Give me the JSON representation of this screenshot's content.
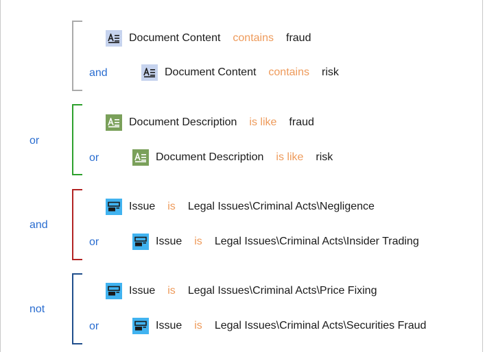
{
  "groups": [
    {
      "op": "",
      "color": "#aaaaaa",
      "conditions": [
        {
          "join": "",
          "field": "Document Content",
          "operator": "contains",
          "value": "fraud",
          "icon": "text-field-icon"
        },
        {
          "join": "and",
          "field": "Document Content",
          "operator": "contains",
          "value": "risk",
          "icon": "text-field-icon"
        }
      ]
    },
    {
      "op": "or",
      "color": "#2ca02c",
      "conditions": [
        {
          "join": "",
          "field": "Document Description",
          "operator": "is like",
          "value": "fraud",
          "icon": "text-field-icon"
        },
        {
          "join": "or",
          "field": "Document Description",
          "operator": "is like",
          "value": "risk",
          "icon": "text-field-icon"
        }
      ]
    },
    {
      "op": "and",
      "color": "#b22222",
      "conditions": [
        {
          "join": "",
          "field": "Issue",
          "operator": "is",
          "value": "Legal Issues\\Criminal Acts\\Negligence",
          "icon": "choice-field-icon"
        },
        {
          "join": "or",
          "field": "Issue",
          "operator": "is",
          "value": "Legal Issues\\Criminal Acts\\Insider Trading",
          "icon": "choice-field-icon"
        }
      ]
    },
    {
      "op": "not",
      "color": "#1f4e8c",
      "conditions": [
        {
          "join": "",
          "field": "Issue",
          "operator": "is",
          "value": "Legal Issues\\Criminal Acts\\Price Fixing",
          "icon": "choice-field-icon"
        },
        {
          "join": "or",
          "field": "Issue",
          "operator": "is",
          "value": "Legal Issues\\Criminal Acts\\Securities Fraud",
          "icon": "choice-field-icon"
        }
      ]
    }
  ]
}
